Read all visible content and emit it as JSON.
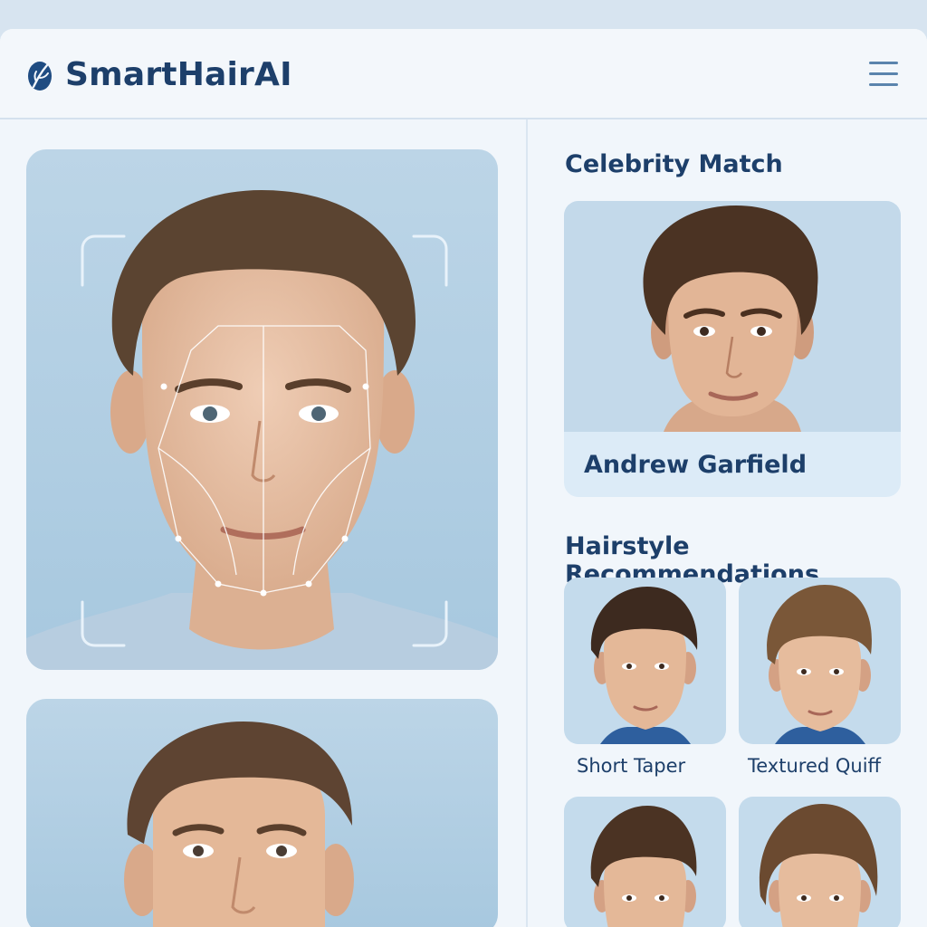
{
  "header": {
    "brand": "SmartHairAI",
    "logo_icon": "leaf-icon",
    "menu_icon": "hamburger-menu-icon"
  },
  "colors": {
    "accent": "#1d3f6a",
    "menu": "#5a84ad",
    "panel": "#f1f6fb",
    "photo_bg": "#b3cfe3"
  },
  "analysis": {
    "photo_description": "user-face-scan-photo",
    "preview_description": "hairstyle-preview-photo"
  },
  "celebrity": {
    "title": "Celebrity Match",
    "name": "Andrew Garfield"
  },
  "recommendations": {
    "title": "Hairstyle Recommendations",
    "items": [
      {
        "label": "Short Taper"
      },
      {
        "label": "Textured Quiff"
      },
      {
        "label": ""
      },
      {
        "label": ""
      }
    ]
  }
}
